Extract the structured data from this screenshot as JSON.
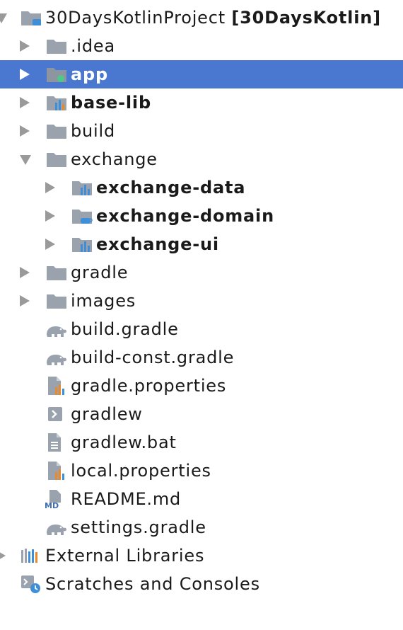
{
  "project_tree": {
    "root": {
      "label": "30DaysKotlinProject",
      "module": "[30DaysKotlin]"
    },
    "items": [
      {
        "label": ".idea"
      },
      {
        "label": "app"
      },
      {
        "label": "base-lib"
      },
      {
        "label": "build"
      },
      {
        "label": "exchange"
      },
      {
        "label": "exchange-data"
      },
      {
        "label": "exchange-domain"
      },
      {
        "label": "exchange-ui"
      },
      {
        "label": "gradle"
      },
      {
        "label": "images"
      },
      {
        "label": "build.gradle"
      },
      {
        "label": "build-const.gradle"
      },
      {
        "label": "gradle.properties"
      },
      {
        "label": "gradlew"
      },
      {
        "label": "gradlew.bat"
      },
      {
        "label": "local.properties"
      },
      {
        "label": "README.md"
      },
      {
        "label": "settings.gradle"
      }
    ],
    "external_libraries": "External Libraries",
    "scratches": "Scratches and Consoles",
    "md_badge": "MD"
  },
  "colors": {
    "selection": "#4a78d1",
    "folder": "#9aa3ad",
    "module_dot": "#4ec98a",
    "chart_blue": "#3f8fd8",
    "chart_orange": "#e8892b"
  }
}
